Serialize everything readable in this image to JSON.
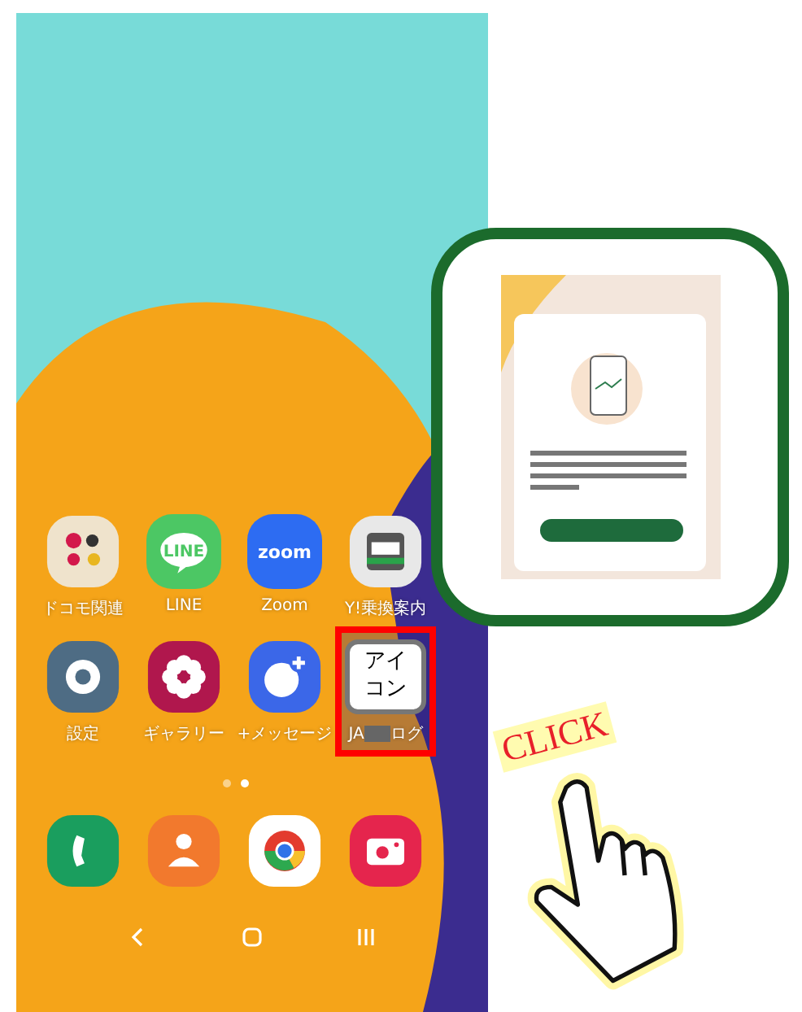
{
  "apps": [
    {
      "kind": "folder",
      "label": "ドコモ関連",
      "highlighted": false
    },
    {
      "kind": "line",
      "label": "LINE",
      "icon_text": "LINE",
      "highlighted": false
    },
    {
      "kind": "zoom",
      "label": "Zoom",
      "icon_text": "zoom",
      "highlighted": false
    },
    {
      "kind": "train",
      "label": "Y!乗換案内",
      "highlighted": false
    },
    {
      "kind": "settings",
      "label": "設定",
      "highlighted": false
    },
    {
      "kind": "gallery",
      "label": "ギャラリー",
      "highlighted": false
    },
    {
      "kind": "message",
      "label": "+メッセージ",
      "highlighted": false
    },
    {
      "kind": "custom",
      "icon_text": "アイコン",
      "label": "JA",
      "label_end": "ログ",
      "highlighted": true
    }
  ],
  "page_dots": [
    {
      "selected": false
    },
    {
      "selected": true
    }
  ],
  "dock": [
    {
      "kind": "phone"
    },
    {
      "kind": "contacts"
    },
    {
      "kind": "browser"
    },
    {
      "kind": "camera"
    }
  ],
  "callout": {
    "click_label": "CLICK"
  }
}
